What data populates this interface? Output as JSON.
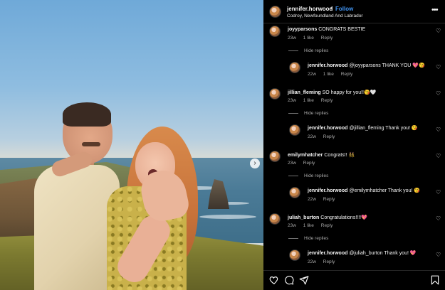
{
  "post": {
    "username": "jennifer.horwood",
    "separator": "•",
    "follow_label": "Follow",
    "location": "Codroy, Newfoundland And Labrador",
    "more_icon": "more-horizontal-icon"
  },
  "photo": {
    "next_icon": "chevron-right-icon",
    "next_glyph": "›"
  },
  "comments": [
    {
      "username": "joyyparsons",
      "text": "CONGRATS BESTIE",
      "age": "23w",
      "likes": "1 like",
      "reply_label": "Reply",
      "hide_label": "Hide replies",
      "reply": {
        "username": "jennifer.horwood",
        "text": "@joyyparsons THANK YOU 💖😘",
        "age": "22w",
        "likes": "1 like",
        "reply_label": "Reply"
      }
    },
    {
      "username": "jillian_fleming",
      "text": "SO happy for you!!😘🤍",
      "age": "23w",
      "likes": "1 like",
      "reply_label": "Reply",
      "hide_label": "Hide replies",
      "reply": {
        "username": "jennifer.horwood",
        "text": "@jillian_fleming Thank you! 😘",
        "age": "22w",
        "likes": "",
        "reply_label": "Reply"
      }
    },
    {
      "username": "emilymhatcher",
      "text": "Congrats!! 👯‍♀️",
      "age": "23w",
      "likes": "",
      "reply_label": "Reply",
      "hide_label": "Hide replies",
      "reply": {
        "username": "jennifer.horwood",
        "text": "@emilymhatcher Thank you! 😘",
        "age": "22w",
        "likes": "",
        "reply_label": "Reply"
      }
    },
    {
      "username": "juliah_burton",
      "text": "Congratulations!!!!💖",
      "age": "23w",
      "likes": "1 like",
      "reply_label": "Reply",
      "hide_label": "Hide replies",
      "reply": {
        "username": "jennifer.horwood",
        "text": "@juliah_burton Thank you! 💖",
        "age": "22w",
        "likes": "",
        "reply_label": "Reply"
      }
    }
  ],
  "actions": {
    "like_icon": "heart-icon",
    "comment_icon": "comment-icon",
    "share_icon": "send-icon",
    "save_icon": "bookmark-icon"
  },
  "colors": {
    "background": "#000000",
    "accent": "#4193ef",
    "muted": "#a8a8a8"
  }
}
